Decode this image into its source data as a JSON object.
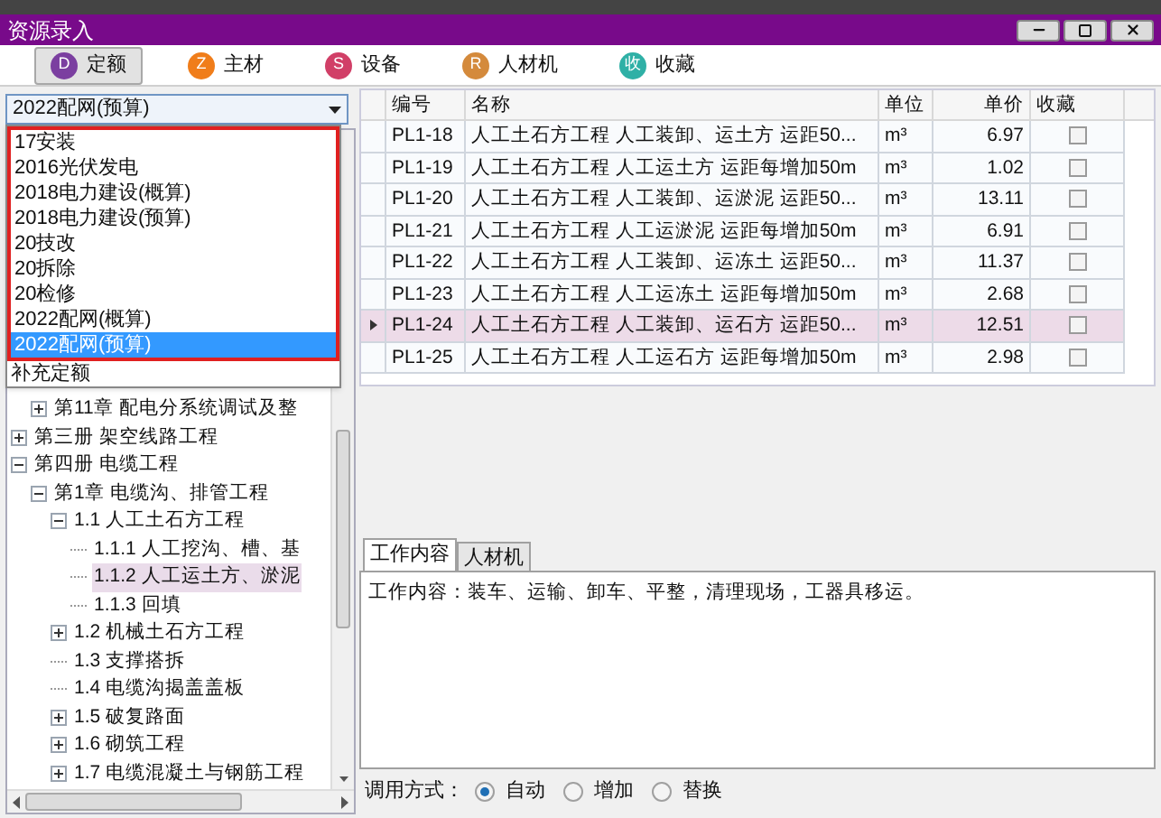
{
  "window": {
    "title": "资源录入"
  },
  "toolbar_tabs": [
    {
      "badge": "D",
      "label": "定额",
      "color": "#7b3fa0",
      "selected": true
    },
    {
      "badge": "Z",
      "label": "主材",
      "color": "#f07d1a",
      "selected": false
    },
    {
      "badge": "S",
      "label": "设备",
      "color": "#d13f67",
      "selected": false
    },
    {
      "badge": "R",
      "label": "人材机",
      "color": "#d48a3c",
      "selected": false
    },
    {
      "badge": "收",
      "label": "收藏",
      "color": "#2fb0a6",
      "selected": false
    }
  ],
  "library_dropdown": {
    "value": "2022配网(预算)",
    "expanded": true,
    "options": [
      {
        "label": "17安装",
        "selected": false,
        "outlined": true
      },
      {
        "label": "2016光伏发电",
        "selected": false,
        "outlined": true
      },
      {
        "label": "2018电力建设(概算)",
        "selected": false,
        "outlined": true
      },
      {
        "label": "2018电力建设(预算)",
        "selected": false,
        "outlined": true
      },
      {
        "label": "20技改",
        "selected": false,
        "outlined": true
      },
      {
        "label": "20拆除",
        "selected": false,
        "outlined": true
      },
      {
        "label": "20检修",
        "selected": false,
        "outlined": true
      },
      {
        "label": "2022配网(概算)",
        "selected": false,
        "outlined": true
      },
      {
        "label": "2022配网(预算)",
        "selected": true,
        "outlined": true
      },
      {
        "label": "补充定额",
        "selected": false,
        "outlined": false
      }
    ]
  },
  "tree": {
    "offscreen_parent_children": [
      {
        "label": "第11章 配电分系统调试及整",
        "kind": "branch",
        "expanded": false,
        "selected": false
      }
    ],
    "items": [
      {
        "label": "第三册 架空线路工程",
        "kind": "branch",
        "expanded": false,
        "selected": false
      },
      {
        "label": "第四册 电缆工程",
        "kind": "branch",
        "expanded": true,
        "selected": false,
        "children": [
          {
            "label": "第1章 电缆沟、排管工程",
            "kind": "branch",
            "expanded": true,
            "selected": false,
            "children": [
              {
                "label": "1.1 人工土石方工程",
                "kind": "branch",
                "expanded": true,
                "selected": false,
                "children": [
                  {
                    "label": "1.1.1 人工挖沟、槽、基",
                    "kind": "leaf",
                    "selected": false
                  },
                  {
                    "label": "1.1.2 人工运土方、淤泥",
                    "kind": "leaf",
                    "selected": true
                  },
                  {
                    "label": "1.1.3 回填",
                    "kind": "leaf",
                    "selected": false
                  }
                ]
              },
              {
                "label": "1.2 机械土石方工程",
                "kind": "branch",
                "expanded": false,
                "selected": false
              },
              {
                "label": "1.3 支撑搭拆",
                "kind": "leaf",
                "selected": false
              },
              {
                "label": "1.4 电缆沟揭盖盖板",
                "kind": "leaf",
                "selected": false
              },
              {
                "label": "1.5 破复路面",
                "kind": "branch",
                "expanded": false,
                "selected": false
              },
              {
                "label": "1.6 砌筑工程",
                "kind": "branch",
                "expanded": false,
                "selected": false
              },
              {
                "label": "1.7 电缆混凝土与钢筋工程",
                "kind": "branch",
                "expanded": false,
                "selected": false
              }
            ]
          }
        ]
      }
    ]
  },
  "table": {
    "columns": [
      "编号",
      "名称",
      "单位",
      "单价",
      "收藏"
    ],
    "rows": [
      {
        "code": "PL1-18",
        "name": "人工土石方工程 人工装卸、运土方 运距50...",
        "unit": "m³",
        "price": "6.97",
        "favorite": false,
        "selected": false
      },
      {
        "code": "PL1-19",
        "name": "人工土石方工程 人工运土方 运距每增加50m",
        "unit": "m³",
        "price": "1.02",
        "favorite": false,
        "selected": false
      },
      {
        "code": "PL1-20",
        "name": "人工土石方工程 人工装卸、运淤泥 运距50...",
        "unit": "m³",
        "price": "13.11",
        "favorite": false,
        "selected": false
      },
      {
        "code": "PL1-21",
        "name": "人工土石方工程 人工运淤泥 运距每增加50m",
        "unit": "m³",
        "price": "6.91",
        "favorite": false,
        "selected": false
      },
      {
        "code": "PL1-22",
        "name": "人工土石方工程 人工装卸、运冻土 运距50...",
        "unit": "m³",
        "price": "11.37",
        "favorite": false,
        "selected": false
      },
      {
        "code": "PL1-23",
        "name": "人工土石方工程 人工运冻土 运距每增加50m",
        "unit": "m³",
        "price": "2.68",
        "favorite": false,
        "selected": false
      },
      {
        "code": "PL1-24",
        "name": "人工土石方工程 人工装卸、运石方 运距50...",
        "unit": "m³",
        "price": "12.51",
        "favorite": false,
        "selected": true
      },
      {
        "code": "PL1-25",
        "name": "人工土石方工程 人工运石方 运距每增加50m",
        "unit": "m³",
        "price": "2.98",
        "favorite": false,
        "selected": false
      }
    ]
  },
  "detail_tabs": [
    {
      "label": "工作内容",
      "selected": true
    },
    {
      "label": "人材机",
      "selected": false
    }
  ],
  "detail_text": "工作内容：装车、运输、卸车、平整，清理现场，工器具移运。",
  "call_mode": {
    "label": "调用方式：",
    "options": [
      {
        "label": "自动",
        "selected": true
      },
      {
        "label": "增加",
        "selected": false
      },
      {
        "label": "替换",
        "selected": false
      }
    ]
  }
}
